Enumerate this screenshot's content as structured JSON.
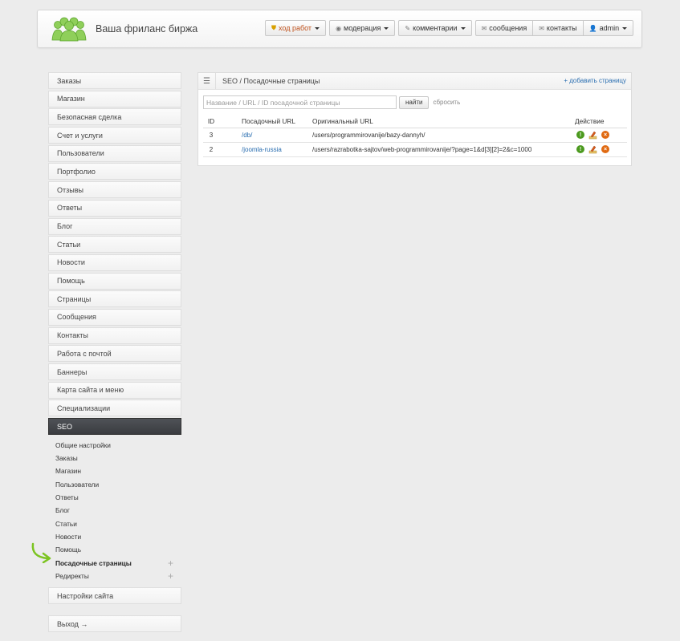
{
  "header": {
    "brand": "Ваша фриланс биржа",
    "nav": [
      {
        "label": "ход работ",
        "icon": "shield-icon"
      },
      {
        "label": "модерация",
        "icon": "eye-icon"
      },
      {
        "label": "комментарии",
        "icon": "pencil-icon"
      },
      {
        "label": "сообщения",
        "icon": "envelope-icon"
      },
      {
        "label": "контакты",
        "icon": "envelope-icon"
      },
      {
        "label": "admin",
        "icon": "user-icon"
      }
    ]
  },
  "sidebar": {
    "items": [
      "Заказы",
      "Магазин",
      "Безопасная сделка",
      "Счет и услуги",
      "Пользователи",
      "Портфолио",
      "Отзывы",
      "Ответы",
      "Блог",
      "Статьи",
      "Новости",
      "Помощь",
      "Страницы",
      "Сообщения",
      "Контакты",
      "Работа с почтой",
      "Баннеры",
      "Карта сайта и меню",
      "Специализации"
    ],
    "active": "SEO",
    "sub": [
      "Общие настройки",
      "Заказы",
      "Магазин",
      "Пользователи",
      "Ответы",
      "Блог",
      "Статьи",
      "Новости",
      "Помощь"
    ],
    "sub_current": "Посадочные страницы",
    "sub_last": "Редиректы",
    "settings": "Настройки сайта",
    "logout": "Выход →"
  },
  "panel": {
    "breadcrumb": "SEO / Посадочные страницы",
    "add_link": "+ добавить страницу",
    "filter": {
      "placeholder": "Название / URL / ID посадочной страницы",
      "value": "",
      "search_button": "найти",
      "reset": "сбросить"
    },
    "table": {
      "headers": {
        "id": "ID",
        "landing": "Посадочный URL",
        "original": "Оригинальный URL",
        "action": "Действие"
      },
      "rows": [
        {
          "id": "3",
          "landing": "/db/",
          "original": "/users/programmirovanije/bazy-dannyh/"
        },
        {
          "id": "2",
          "landing": "/joomla-russia",
          "original": "/users/razrabotka-sajtov/web-programmirovanije/?page=1&d[3][2]=2&c=1000"
        }
      ]
    }
  },
  "colors": {
    "accent_link": "#2a6eb0",
    "active_bg": "#3a3c40",
    "info": "#4c9a1f",
    "delete": "#e06a12",
    "arrow": "#7cc421"
  }
}
